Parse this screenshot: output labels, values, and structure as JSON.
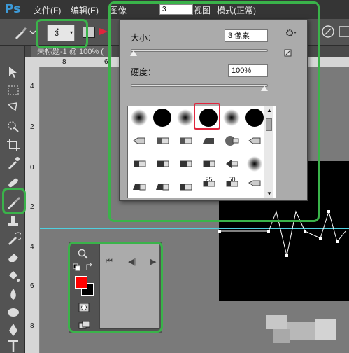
{
  "app": {
    "logo": "Ps"
  },
  "menu": {
    "file": "文件(F)",
    "edit": "编辑(E)",
    "image_partial": "图像",
    "field_value": "3",
    "view_partial": "视图",
    "mode_partial": "模式(正常)"
  },
  "options": {
    "brush_size": "3",
    "brush_dot": "•"
  },
  "document": {
    "tab_title": "未标题-1 @ 100% ("
  },
  "ruler": {
    "top_8": "8",
    "top_6": "6",
    "left_4": "4",
    "left_2": "2",
    "left_0": "0",
    "left_2b": "2",
    "left_4b": "4",
    "left_6": "6",
    "left_8": "8"
  },
  "brush_popup": {
    "size_label": "大小：",
    "size_value": "3 像素",
    "hardness_label": "硬度：",
    "hardness_value": "100%",
    "size_percent": 0.02,
    "hardness_percent": 1.0,
    "brush_labels": [
      "25",
      "50"
    ]
  },
  "colors": {
    "foreground": "#ff0000",
    "background": "#000000",
    "highlight": "#3ab34a",
    "selection": "#e0253d"
  }
}
